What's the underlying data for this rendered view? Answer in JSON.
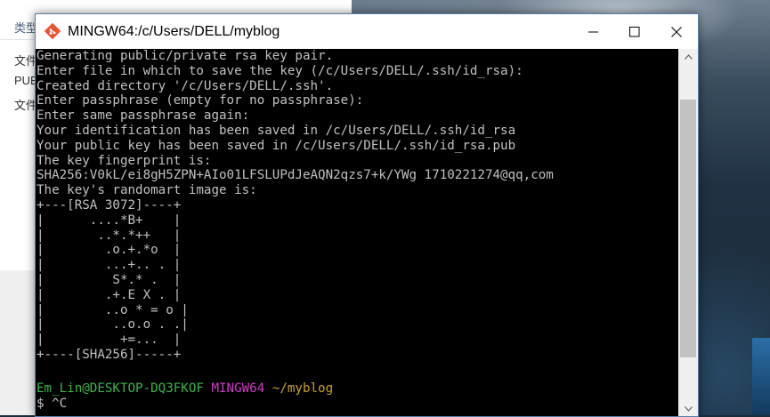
{
  "background": {
    "explorer_header": "类型",
    "explorer_rows": [
      "文件",
      "PUB",
      "文件"
    ]
  },
  "window": {
    "title": "MINGW64:/c/Users/DELL/myblog",
    "icon": "git-bash-icon",
    "controls": [
      "minimize-icon",
      "maximize-icon",
      "close-icon"
    ]
  },
  "terminal": {
    "lines": [
      "Generating public/private rsa key pair.",
      "Enter file in which to save the key (/c/Users/DELL/.ssh/id_rsa):",
      "Created directory '/c/Users/DELL/.ssh'.",
      "Enter passphrase (empty for no passphrase):",
      "Enter same passphrase again:",
      "Your identification has been saved in /c/Users/DELL/.ssh/id_rsa",
      "Your public key has been saved in /c/Users/DELL/.ssh/id_rsa.pub",
      "The key fingerprint is:",
      "SHA256:V0kL/ei8gH5ZPN+AIo01LFSLUPdJeAQN2qzs7+k/YWg 1710221274@qq,com",
      "The key's randomart image is:",
      "+---[RSA 3072]----+",
      "|      ....*B+    |",
      "|       ..*.*++   |",
      "|        .o.+.*o  |",
      "|        ...+.. . |",
      "|         S*.* .  |",
      "|        .+.E X . |",
      "|        ..o * = o |",
      "|         ..o.o . .|",
      "|          +=...  |",
      "+----[SHA256]-----+"
    ],
    "prompt": {
      "user_host": "Em_Lin@DESKTOP-DQ3FKOF",
      "system": "MINGW64",
      "path": "~/myblog"
    },
    "input_line": "$ ^C"
  },
  "colors": {
    "prompt_user": "#39b54a",
    "prompt_system": "#d039c9",
    "prompt_path": "#c7a12b",
    "terminal_text": "#c0c0c0"
  }
}
